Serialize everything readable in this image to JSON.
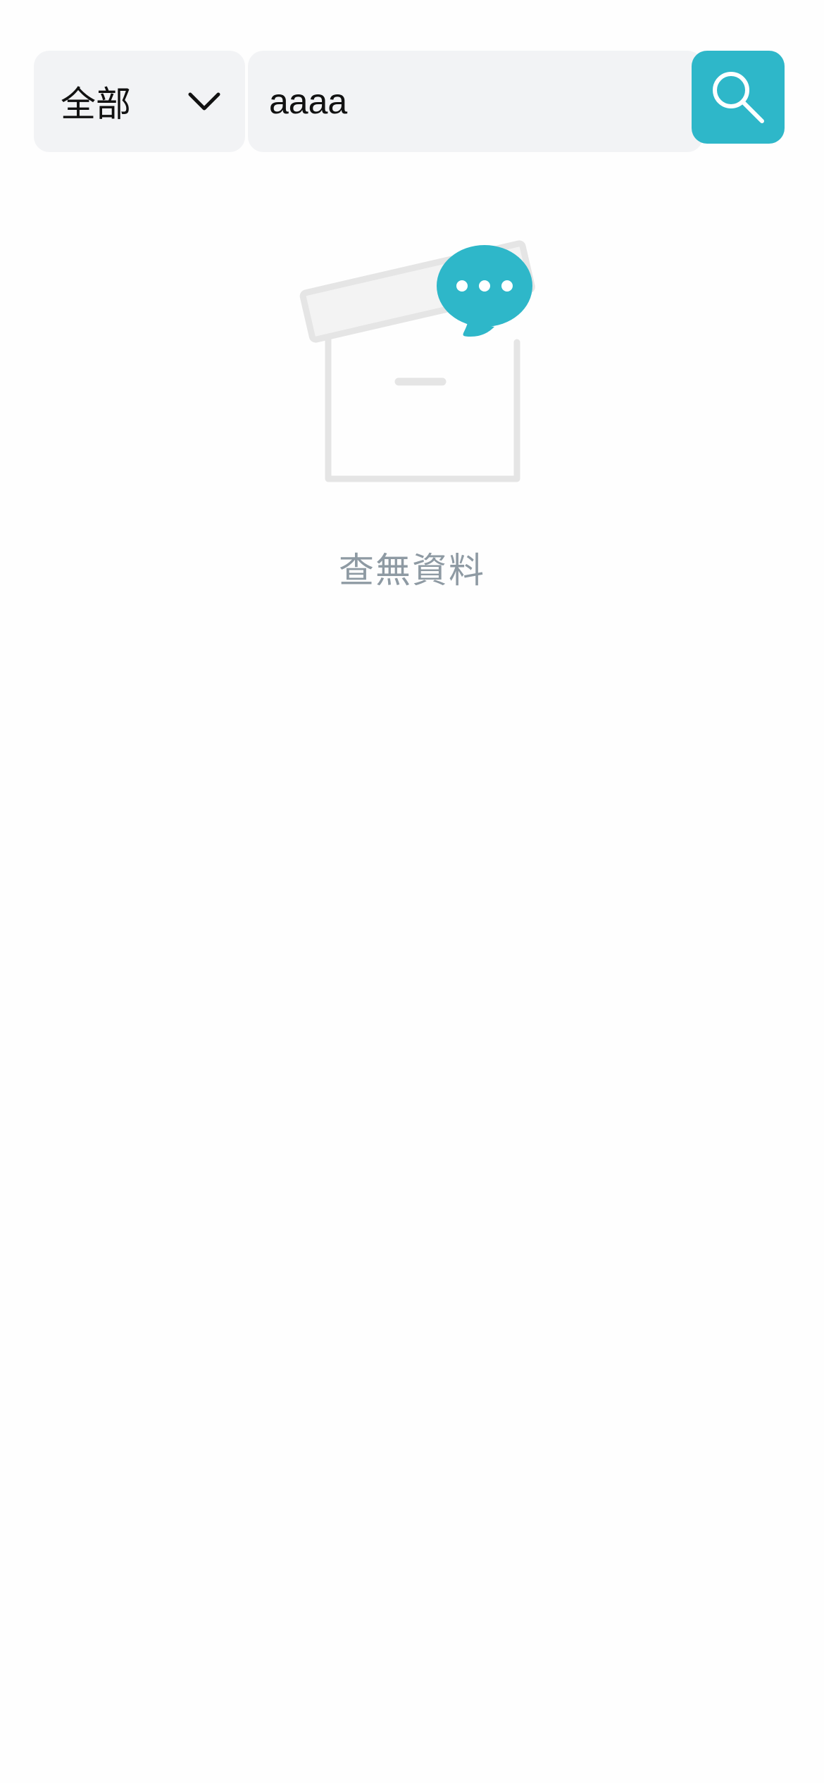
{
  "search": {
    "category_selected": "全部",
    "category_icon": "chevron-down-icon",
    "query_value": "aaaa",
    "button_icon": "search-icon"
  },
  "empty_state": {
    "illustration_icon": "empty-box-chat-icon",
    "message": "查無資料"
  },
  "colors": {
    "accent": "#2eb7c9",
    "field_background": "#f2f3f5",
    "muted_text": "#8e9aa3",
    "illustration_gray": "#e5e5e5"
  }
}
